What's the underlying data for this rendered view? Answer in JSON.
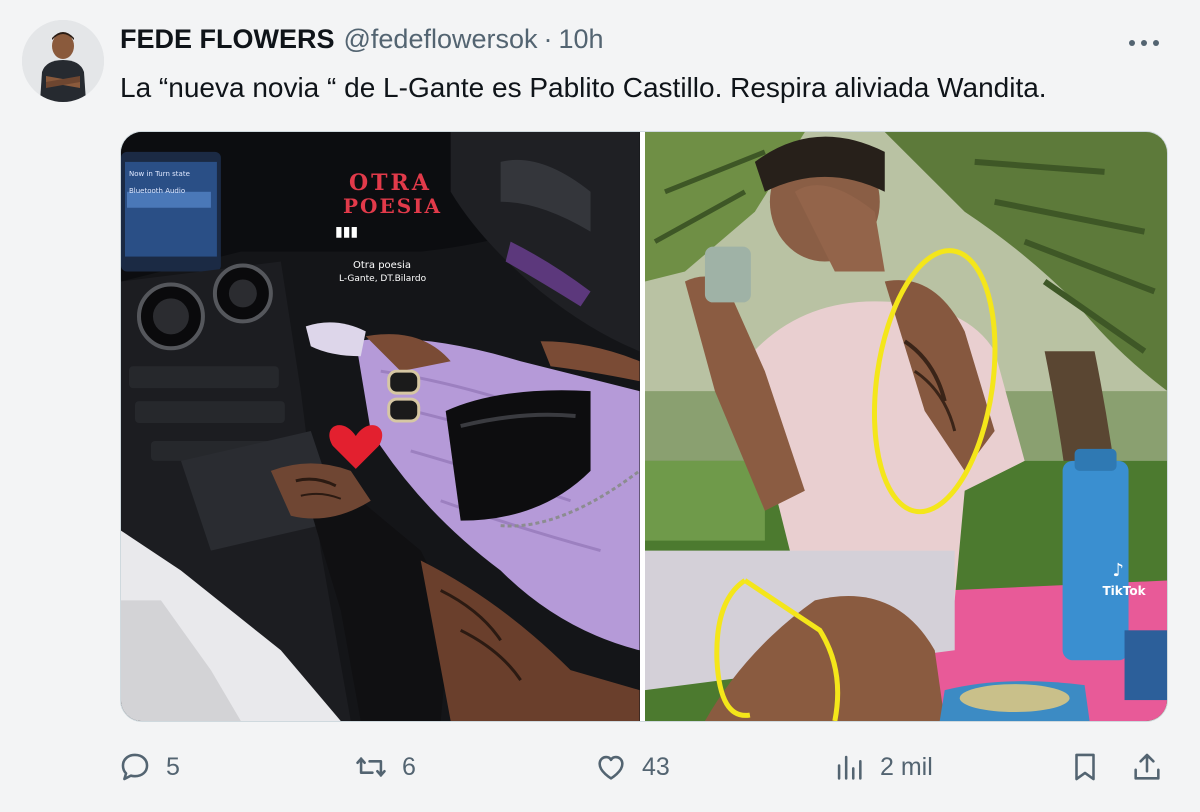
{
  "tweet": {
    "author_name": "FEDE FLOWERS",
    "handle": "@fedeflowersok",
    "separator": "·",
    "time": "10h",
    "text": "La “nueva novia “ de L-Gante es Pablito Castillo. Respira aliviada Wandita."
  },
  "media": {
    "left_photo": {
      "logo_line1": "OTRA",
      "logo_line2": "POESIA",
      "song_title": "Otra poesia",
      "song_artist": "L-Gante, DT.Bilardo",
      "car_screen_text1": "Bluetooth Audio",
      "car_screen_text2": "Now in Turn state"
    },
    "right_photo": {
      "watermark": "TikTok"
    }
  },
  "actions": {
    "replies": "5",
    "retweets": "6",
    "likes": "43",
    "views": "2 mil"
  },
  "colors": {
    "text_primary": "#0f1419",
    "text_secondary": "#536471",
    "annotation_yellow": "#f4e61a"
  },
  "icons": {
    "reply": "reply-icon",
    "retweet": "retweet-icon",
    "like": "heart-icon",
    "views": "bar-chart-icon",
    "bookmark": "bookmark-icon",
    "share": "share-icon",
    "more": "more-icon"
  }
}
